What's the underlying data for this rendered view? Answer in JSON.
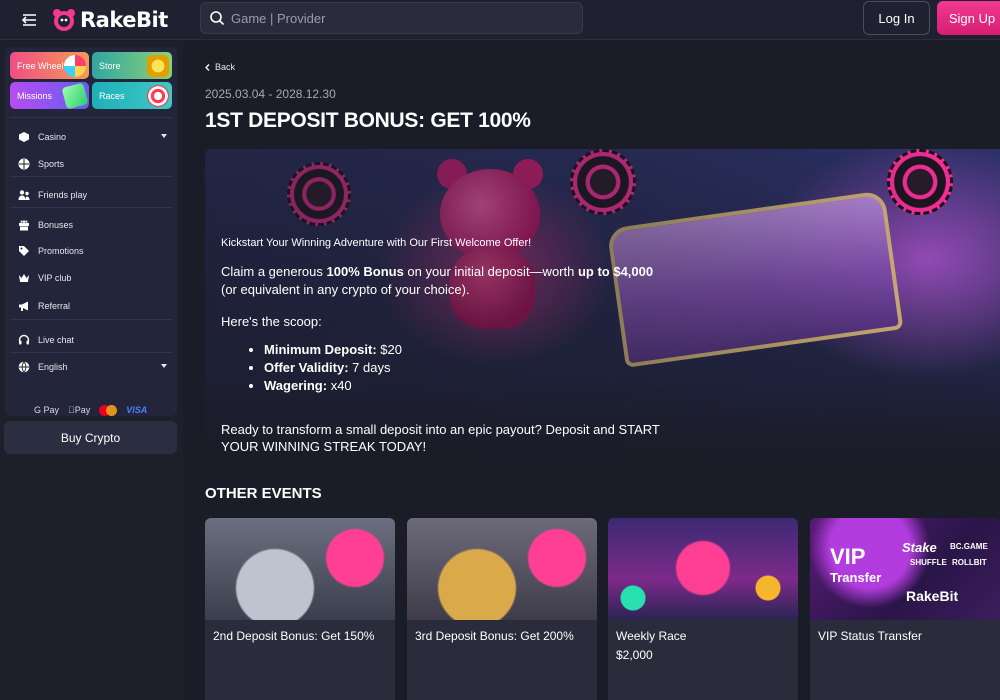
{
  "header": {
    "logo_text": "RakeBit",
    "search_placeholder": "Game | Provider",
    "login_label": "Log In",
    "signup_label": "Sign Up"
  },
  "sidebar": {
    "promo_tiles": [
      {
        "label": "Free Wheel"
      },
      {
        "label": "Store"
      },
      {
        "label": "Missions"
      },
      {
        "label": "Races"
      }
    ],
    "nav": [
      {
        "label": "Casino",
        "icon": "cube-icon"
      },
      {
        "label": "Sports",
        "icon": "ball-icon"
      },
      {
        "label": "Friends play",
        "icon": "users-icon"
      },
      {
        "label": "Bonuses",
        "icon": "gift-icon"
      },
      {
        "label": "Promotions",
        "icon": "tag-icon"
      },
      {
        "label": "VIP club",
        "icon": "crown-icon"
      },
      {
        "label": "Referral",
        "icon": "megaphone-icon"
      },
      {
        "label": "Live chat",
        "icon": "headset-icon"
      },
      {
        "label": "English",
        "icon": "globe-icon"
      }
    ],
    "payments": {
      "gpay": "G Pay",
      "applepay": "Pay",
      "visa": "VISA"
    },
    "buy_crypto_label": "Buy Crypto"
  },
  "main": {
    "back_label": "Back",
    "date_range": "2025.03.04 - 2028.12.30",
    "title": "1ST DEPOSIT BONUS: GET 100%",
    "banner": {
      "intro": "Kickstart Your Winning Adventure with Our First Welcome Offer!",
      "claim_pre": "Claim a generous ",
      "claim_bold1": "100% Bonus",
      "claim_mid": " on your initial deposit—worth ",
      "claim_bold2": "up to $4,000",
      "claim_post": " (or equivalent in any crypto of your choice).",
      "scoop": "Here's the scoop:",
      "bullets": [
        {
          "label": "Minimum Deposit:",
          "value": " $20"
        },
        {
          "label": "Offer Validity:",
          "value": " 7 days"
        },
        {
          "label": "Wagering:",
          "value": " x40"
        }
      ],
      "outro": "Ready to transform a small deposit into an epic payout? Deposit and START YOUR WINNING STREAK TODAY!"
    },
    "other_events_title": "OTHER EVENTS",
    "events": [
      {
        "title": "2nd Deposit Bonus: Get 150%",
        "sub": ""
      },
      {
        "title": "3rd Deposit Bonus: Get 200%",
        "sub": ""
      },
      {
        "title": "Weekly Race",
        "sub": "$2,000"
      },
      {
        "title": "VIP Status Transfer",
        "sub": "",
        "img_vip": "VIP",
        "img_transfer": "Transfer",
        "img_brand": "RakeBit",
        "img_logos": [
          "Stake",
          "BC.GAME",
          "SHUFFLE",
          "ROLLBIT"
        ]
      }
    ]
  },
  "colors": {
    "accent": "#e8287e",
    "background": "#1a1c27",
    "panel": "#23263a"
  }
}
